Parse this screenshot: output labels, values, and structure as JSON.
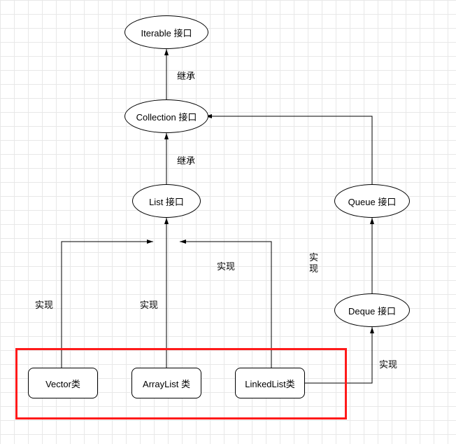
{
  "nodes": {
    "iterable": {
      "label": "Iterable 接口"
    },
    "collection": {
      "label": "Collection 接口"
    },
    "list": {
      "label": "List 接口"
    },
    "queue": {
      "label": "Queue 接口"
    },
    "deque": {
      "label": "Deque 接口"
    },
    "vector": {
      "label": "Vector类"
    },
    "arraylist": {
      "label": "ArrayList 类"
    },
    "linkedlist": {
      "label": "LinkedList类"
    }
  },
  "edgeLabels": {
    "coll_to_iter": "继承",
    "list_to_coll": "继承",
    "vec_to_list": "实现",
    "arr_to_list": "实现",
    "lnk_to_list": "实现",
    "lnk_to_deque": "实现",
    "deque_to_queue": "实现"
  },
  "chart_data": {
    "type": "diagram",
    "title": "",
    "nodes": [
      {
        "id": "iterable",
        "label": "Iterable 接口",
        "kind": "interface"
      },
      {
        "id": "collection",
        "label": "Collection 接口",
        "kind": "interface"
      },
      {
        "id": "list",
        "label": "List 接口",
        "kind": "interface"
      },
      {
        "id": "queue",
        "label": "Queue 接口",
        "kind": "interface"
      },
      {
        "id": "deque",
        "label": "Deque 接口",
        "kind": "interface"
      },
      {
        "id": "vector",
        "label": "Vector类",
        "kind": "class",
        "highlighted": true
      },
      {
        "id": "arraylist",
        "label": "ArrayList 类",
        "kind": "class",
        "highlighted": true
      },
      {
        "id": "linkedlist",
        "label": "LinkedList类",
        "kind": "class",
        "highlighted": true
      }
    ],
    "edges": [
      {
        "from": "collection",
        "to": "iterable",
        "relation": "继承"
      },
      {
        "from": "list",
        "to": "collection",
        "relation": "继承"
      },
      {
        "from": "queue",
        "to": "collection",
        "relation": "继承"
      },
      {
        "from": "vector",
        "to": "list",
        "relation": "实现"
      },
      {
        "from": "arraylist",
        "to": "list",
        "relation": "实现"
      },
      {
        "from": "linkedlist",
        "to": "list",
        "relation": "实现"
      },
      {
        "from": "linkedlist",
        "to": "deque",
        "relation": "实现"
      },
      {
        "from": "deque",
        "to": "queue",
        "relation": "实现"
      }
    ],
    "highlight_group": [
      "vector",
      "arraylist",
      "linkedlist"
    ]
  }
}
